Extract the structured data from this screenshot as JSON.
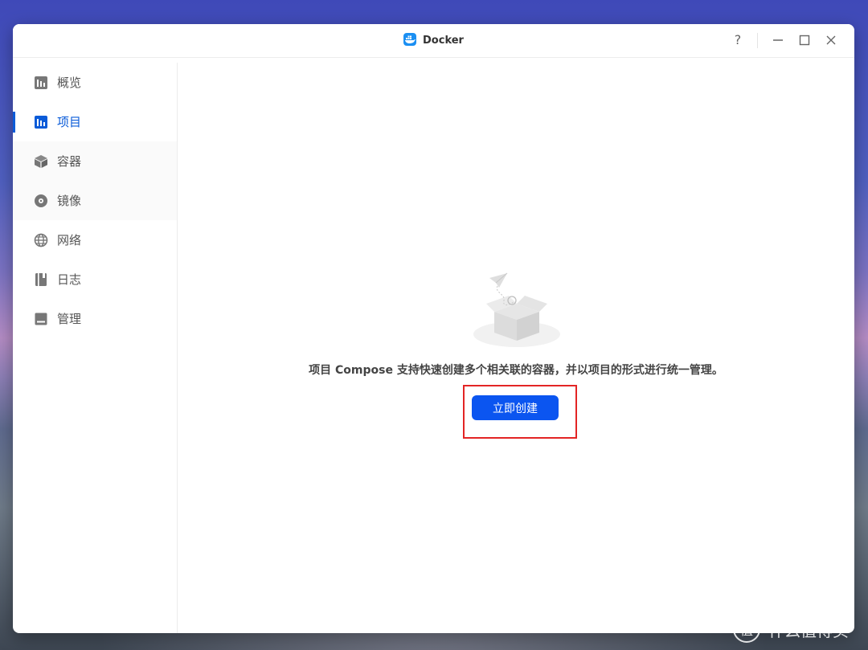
{
  "window": {
    "title": "Docker",
    "help_label": "?"
  },
  "sidebar": {
    "items": [
      {
        "label": "概览",
        "icon": "overview-chart-icon",
        "active": false
      },
      {
        "label": "项目",
        "icon": "project-chart-icon",
        "active": true
      },
      {
        "label": "容器",
        "icon": "container-cube-icon",
        "active": false
      },
      {
        "label": "镜像",
        "icon": "image-disc-icon",
        "active": false
      },
      {
        "label": "网络",
        "icon": "network-globe-icon",
        "active": false
      },
      {
        "label": "日志",
        "icon": "log-book-icon",
        "active": false
      },
      {
        "label": "管理",
        "icon": "management-icon",
        "active": false
      }
    ]
  },
  "main": {
    "empty_message": "项目 Compose 支持快速创建多个相关联的容器，并以项目的形式进行统一管理。",
    "create_button_label": "立即创建"
  },
  "colors": {
    "accent": "#0a5bd8",
    "button": "#0b55f0",
    "highlight": "#e32525"
  },
  "watermark": {
    "text": "什么值得买",
    "icon_glyph": "值"
  }
}
